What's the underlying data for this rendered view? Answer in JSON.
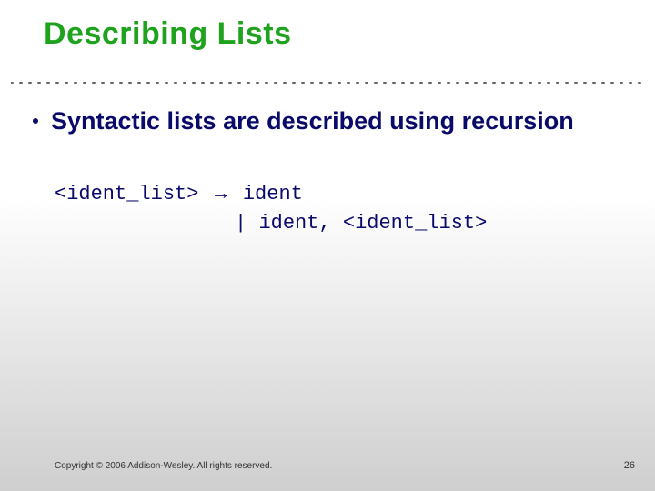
{
  "title": "Describing Lists",
  "bullet": "Syntactic lists are described using recursion",
  "grammar": {
    "lhs": "<ident_list>",
    "arrow": "→",
    "rhs1": "ident",
    "rhs2_prefix": "| ident, ",
    "rhs2_tail": "<ident_list>"
  },
  "footer": "Copyright © 2006 Addison-Wesley. All rights reserved.",
  "page": "26"
}
